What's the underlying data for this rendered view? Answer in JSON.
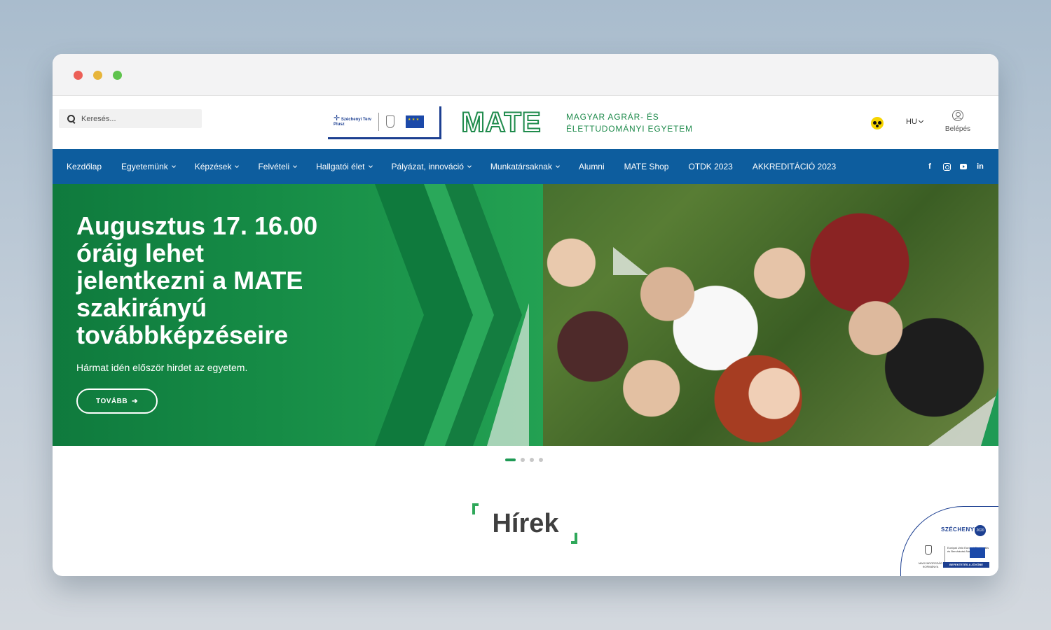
{
  "window": {
    "controls": [
      "close",
      "minimize",
      "maximize"
    ]
  },
  "header": {
    "search_placeholder": "Keresés...",
    "partner_logo_text": "Széchenyi Terv Plusz",
    "partner_logo_subtext": "Magyarország Kormánya · Az Európai Unió támogatásával",
    "logo_text": "MATE",
    "university_name_line1": "MAGYAR AGRÁR- ÉS",
    "university_name_line2": "ÉLETTUDOMÁNYI EGYETEM",
    "language": "HU",
    "login_label": "Belépés"
  },
  "nav": {
    "items": [
      {
        "label": "Kezdőlap",
        "dropdown": false
      },
      {
        "label": "Egyetemünk",
        "dropdown": true
      },
      {
        "label": "Képzések",
        "dropdown": true
      },
      {
        "label": "Felvételi",
        "dropdown": true
      },
      {
        "label": "Hallgatói élet",
        "dropdown": true
      },
      {
        "label": "Pályázat, innováció",
        "dropdown": true
      },
      {
        "label": "Munkatársaknak",
        "dropdown": true
      },
      {
        "label": "Alumni",
        "dropdown": false
      },
      {
        "label": "MATE Shop",
        "dropdown": false
      },
      {
        "label": "OTDK 2023",
        "dropdown": false
      },
      {
        "label": "AKKREDITÁCIÓ 2023",
        "dropdown": false
      }
    ],
    "socials": [
      "facebook-icon",
      "instagram-icon",
      "youtube-icon",
      "linkedin-icon"
    ]
  },
  "hero": {
    "title": "Augusztus 17. 16.00 óráig lehet jelentkezni a MATE szakirányú továbbképzéseire",
    "subtitle": "Hármat idén először hirdet az egyetem.",
    "button_label": "TOVÁBB",
    "slides_total": 4,
    "active_slide": 1
  },
  "news": {
    "title": "Hírek"
  },
  "badge": {
    "title": "SZÉCHENYI",
    "pin_text": "2020",
    "gov_text": "MAGYARORSZÁG KORMÁNYA",
    "eu_text": "Európai Unió Európai Strukturális és Beruházási Alapok",
    "invest_text": "BEFEKTETÉS A JÖVŐBE"
  },
  "colors": {
    "nav_blue": "#0d5d9e",
    "brand_green": "#1f8b4c",
    "accent_green": "#2fa85a",
    "eu_blue": "#1c3f91"
  }
}
